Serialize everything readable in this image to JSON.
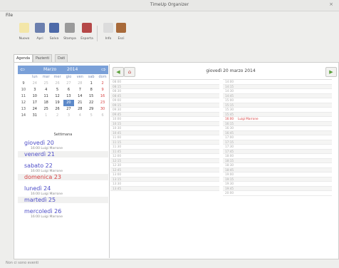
{
  "window": {
    "title": "TimeUp Organizer",
    "close_glyph": "×"
  },
  "menu": {
    "file": "File"
  },
  "toolbar": [
    {
      "label": "Nuovo",
      "icon": "new-document-icon",
      "color": "#f3e6a8"
    },
    {
      "label": "Apri",
      "icon": "open-folder-icon",
      "color": "#6b7fae"
    },
    {
      "label": "Salva",
      "icon": "save-icon",
      "color": "#4d6aa8"
    },
    {
      "label": "Stampa",
      "icon": "print-icon",
      "color": "#9a9a9a"
    },
    {
      "label": "Esporta",
      "icon": "export-icon",
      "color": "#b54848"
    },
    {
      "label": "Info",
      "icon": "info-bulb-icon",
      "color": "#dcdcdc"
    },
    {
      "label": "Esci",
      "icon": "exit-icon",
      "color": "#a86a3a"
    }
  ],
  "tabs": [
    "Agenda",
    "Pazienti",
    "Dati"
  ],
  "calendar": {
    "prev": "⇦",
    "next": "⇨",
    "month": "Marzo",
    "year": "2014",
    "dow": [
      "",
      "lun",
      "mar",
      "mer",
      "gio",
      "ven",
      "sab",
      "dom"
    ],
    "weeks": [
      [
        "9",
        "24",
        "25",
        "26",
        "27",
        "28",
        "1",
        "2"
      ],
      [
        "10",
        "3",
        "4",
        "5",
        "6",
        "7",
        "8",
        "9"
      ],
      [
        "11",
        "10",
        "11",
        "12",
        "13",
        "14",
        "15",
        "16"
      ],
      [
        "12",
        "17",
        "18",
        "19",
        "20",
        "21",
        "22",
        "23"
      ],
      [
        "13",
        "24",
        "25",
        "26",
        "27",
        "28",
        "29",
        "30"
      ],
      [
        "14",
        "31",
        "1",
        "2",
        "3",
        "4",
        "5",
        "6"
      ]
    ]
  },
  "week": {
    "header": "Settimana",
    "days": [
      {
        "label": "giovedì 20",
        "event": "16:00 Luigi Marrone"
      },
      {
        "label": "venerdì 21",
        "event": ""
      },
      {
        "label": "sabato 22",
        "event": "16:00 Luigi Marrone"
      },
      {
        "label": "domenica 23",
        "event": "",
        "sunday": true
      },
      {
        "label": "lunedì 24",
        "event": "16:00 Luigi Marrone"
      },
      {
        "label": "martedì 25",
        "event": ""
      },
      {
        "label": "mercoledì 26",
        "event": "16:00 Luigi Marrone"
      }
    ]
  },
  "day": {
    "title": "giovedì 20 marzo 2014",
    "prev_glyph": "◀",
    "home_glyph": "⌂",
    "next_glyph": "▶",
    "left_slots": [
      "08:00",
      "08:15",
      "08:30",
      "08:45",
      "09:00",
      "09:15",
      "09:30",
      "09:45",
      "10:00",
      "10:15",
      "10:30",
      "10:45",
      "11:00",
      "11:15",
      "11:30",
      "11:45",
      "12:00",
      "12:15",
      "12:30",
      "12:45",
      "13:00",
      "13:15",
      "13:30",
      "13:45"
    ],
    "right_slots": [
      "14:00",
      "14:15",
      "14:30",
      "14:45",
      "15:00",
      "15:15",
      "15:30",
      "15:45",
      "16:00",
      "16:15",
      "16:30",
      "16:45",
      "17:00",
      "17:15",
      "17:30",
      "17:45",
      "18:00",
      "18:15",
      "18:30",
      "18:45",
      "19:00",
      "19:15",
      "19:30",
      "19:45",
      "20:00"
    ],
    "appointment": {
      "time": "16:00",
      "who": "Luigi Marrone"
    }
  },
  "status": "Non ci sono eventi"
}
